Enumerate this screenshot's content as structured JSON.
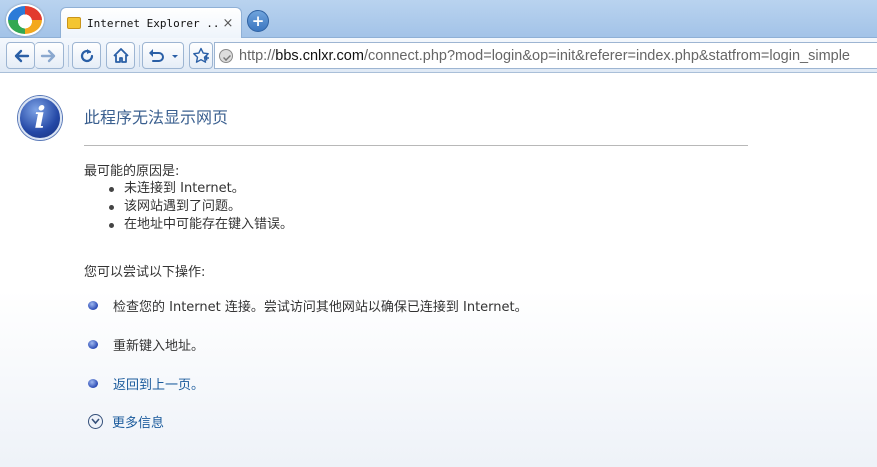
{
  "window": {
    "tab_title": "Internet Explorer ...",
    "close_tab_label": "×",
    "new_tab_label": "+"
  },
  "toolbar": {
    "url_scheme": "http://",
    "url_host": "bbs.cnlxr.com",
    "url_path": "/connect.php?mod=login&op=init&referer=index.php&statfrom=login_simple"
  },
  "page": {
    "title": "此程序无法显示网页",
    "causes_heading": "最可能的原因是:",
    "causes": [
      "未连接到 Internet。",
      "该网站遇到了问题。",
      "在地址中可能存在键入错误。"
    ],
    "tries_heading": "您可以尝试以下操作:",
    "actions": [
      "检查您的 Internet 连接。尝试访问其他网站以确保已连接到 Internet。",
      "重新键入地址。",
      "返回到上一页。"
    ],
    "more_info": "更多信息"
  },
  "icons": [
    "app-logo-icon",
    "favicon-icon",
    "back-icon",
    "forward-icon",
    "refresh-icon",
    "home-icon",
    "undo-icon",
    "favorites-icon",
    "site-info-icon",
    "info-icon",
    "expand-icon"
  ],
  "colors": {
    "link": "#1b5b9c",
    "title": "#3a5f8f",
    "chrome": "#a3c3e8"
  }
}
